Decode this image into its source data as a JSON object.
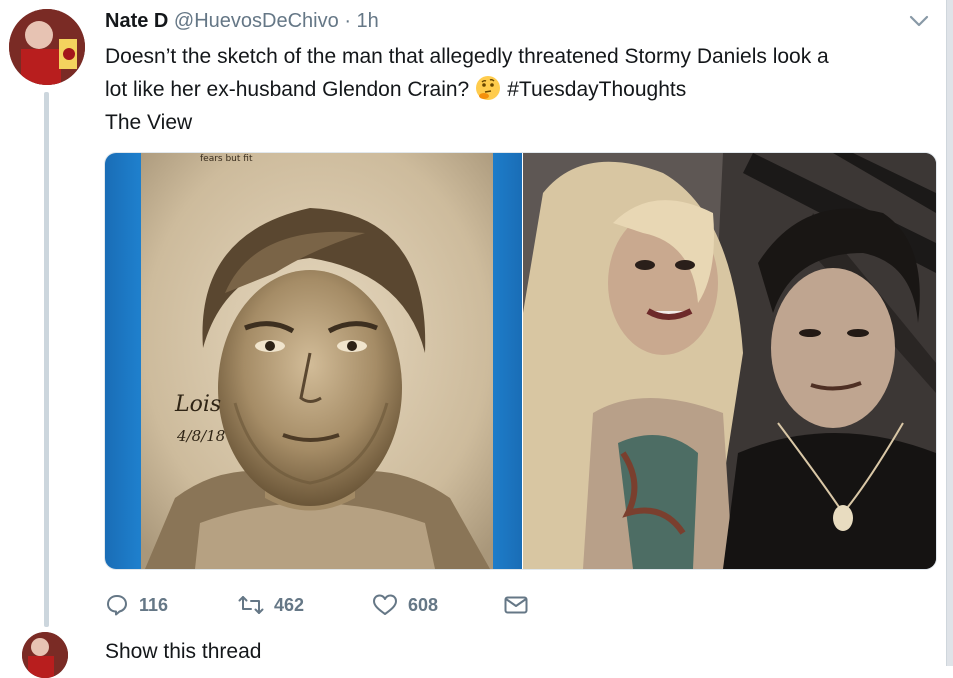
{
  "tweet": {
    "author_name": "Nate D",
    "author_handle": "@HuevosDeChivo",
    "separator": "·",
    "time": "1h",
    "text_line1": "Doesn’t the sketch of the man that allegedly threatened Stormy Daniels look a",
    "text_line2_before": "lot like her ex-husband Glendon Crain?",
    "emoji": "thinking-face-icon",
    "hashtag": "#TuesdayThoughts",
    "text_line3": "The View"
  },
  "media": {
    "sketch_signature": "Lois",
    "sketch_date": "4/8/18",
    "sketch_top_note": "fears but fit"
  },
  "actions": {
    "replies": "116",
    "retweets": "462",
    "likes": "608"
  },
  "footer": {
    "show_thread": "Show this thread"
  },
  "colors": {
    "accent_blue": "#1da1f2",
    "muted_gray": "#657786",
    "text": "#14171a"
  }
}
